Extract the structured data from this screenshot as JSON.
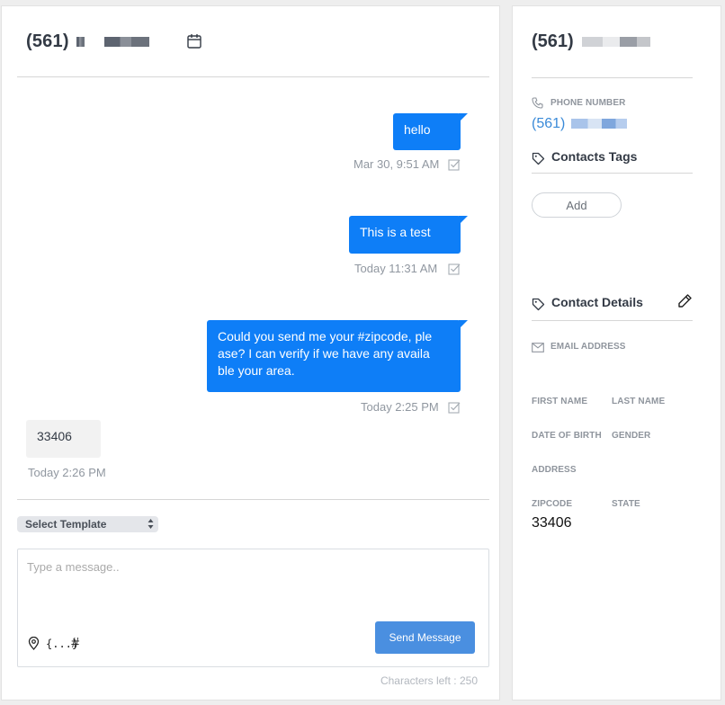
{
  "chat": {
    "header_title": "(561)",
    "messages": [
      {
        "direction": "outgoing",
        "text": "hello",
        "time": "Mar 30, 9:51 AM"
      },
      {
        "direction": "outgoing",
        "text": "This is a test",
        "time": "Today 11:31 AM"
      },
      {
        "direction": "outgoing",
        "lines": [
          "Could you send me your #zipcode, ple",
          "ase? I can verify if we have any availa",
          "ble your area."
        ],
        "time": "Today 2:25 PM"
      },
      {
        "direction": "incoming",
        "text": "33406",
        "time": "Today 2:26 PM"
      }
    ],
    "template_select": "Select Template",
    "message_placeholder": "Type a message..",
    "vars_symbol": "{...}",
    "hash_symbol": "#",
    "send_label": "Send Message",
    "chars_left": "Characters left : 250"
  },
  "contact": {
    "title": "(561)",
    "phone_label": "PHONE NUMBER",
    "phone_value": "(561)",
    "tags_label": "Contacts Tags",
    "add_label": "Add",
    "details_label": "Contact Details",
    "fields": {
      "email": "EMAIL ADDRESS",
      "first_name": "FIRST NAME",
      "last_name": "LAST NAME",
      "dob": "DATE OF BIRTH",
      "gender": "GENDER",
      "address": "ADDRESS",
      "zipcode": "ZIPCODE",
      "state": "STATE"
    },
    "zipcode_value": "33406"
  },
  "colors": {
    "outgoing_bubble": "#0e7ef7",
    "incoming_bubble": "#f2f2f2",
    "send_button": "#4a8fe0",
    "phone_link": "#3a8ad8"
  }
}
